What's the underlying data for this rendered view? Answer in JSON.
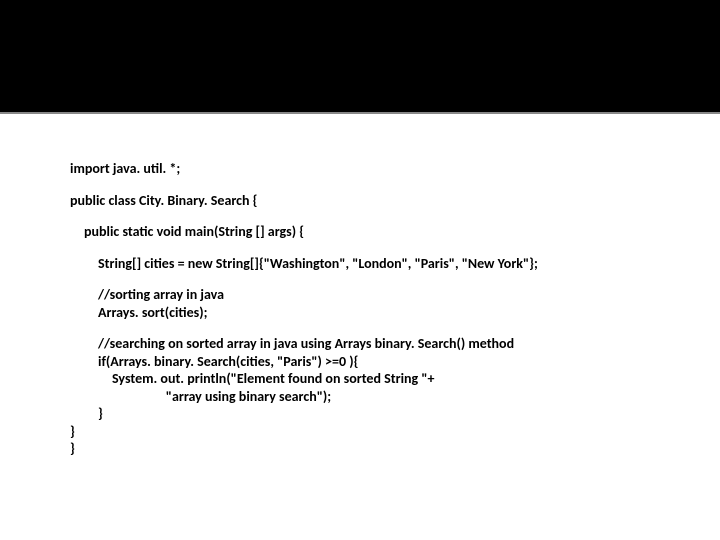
{
  "code": {
    "l1": "import java. util. *;",
    "l2": "public class City. Binary. Search {",
    "l3": "public static void main(String [] args) {",
    "l4": "String[] cities = new String[]{\"Washington\", \"London\", \"Paris\", \"New York\"};",
    "l5": "//sorting array in java",
    "l6": "Arrays. sort(cities);",
    "l7": "//searching on sorted array in java using Arrays binary. Search() method",
    "l8": "if(Arrays. binary. Search(cities, \"Paris\") >=0 ){",
    "l9": "System. out. println(\"Element found on sorted String \"+",
    "l10": "                 \"array using binary search\");",
    "l11": "}",
    "l12": "}",
    "l13": "}"
  }
}
